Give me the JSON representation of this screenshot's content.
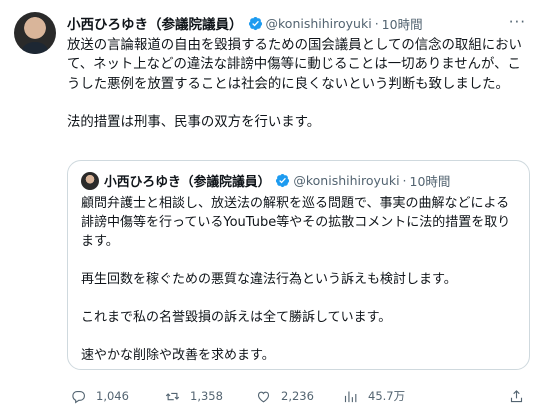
{
  "tweet": {
    "author_name": "小西ひろゆき（参議院議員）",
    "handle": "@konishihiroyuki",
    "separator": "·",
    "time": "10時間",
    "more_label": "···",
    "text_para1": "放送の言論報道の自由を毀損するための国会議員としての信念の取組において、ネット上などの違法な誹謗中傷等に動じることは一切ありませんが、こうした悪例を放置することは社会的に良くないという判断も致しました。",
    "text_para2": "法的措置は刑事、民事の双方を行います。"
  },
  "quoted_tweet": {
    "author_name": "小西ひろゆき（参議院議員）",
    "handle": "@konishihiroyuki",
    "separator": "·",
    "time": "10時間",
    "text": "顧問弁護士と相談し、放送法の解釈を巡る問題で、事実の曲解などによる誹謗中傷等を行っているYouTube等やその拡散コメントに法的措置を取ります。\n\n再生回数を稼ぐための悪質な違法行為という訴えも検討します。\n\nこれまで私の名誉毀損の訴えは全て勝訴しています。\n\n速やかな削除や改善を求めます。"
  },
  "actions": {
    "replies": "1,046",
    "retweets": "1,358",
    "likes": "2,236",
    "views": "45.7万"
  },
  "colors": {
    "verified": "#1d9bf0",
    "secondary_text": "#536471",
    "border": "#cfd9de"
  },
  "icons": [
    "verified-badge-icon",
    "more-icon",
    "reply-icon",
    "retweet-icon",
    "like-icon",
    "views-icon",
    "share-icon"
  ]
}
